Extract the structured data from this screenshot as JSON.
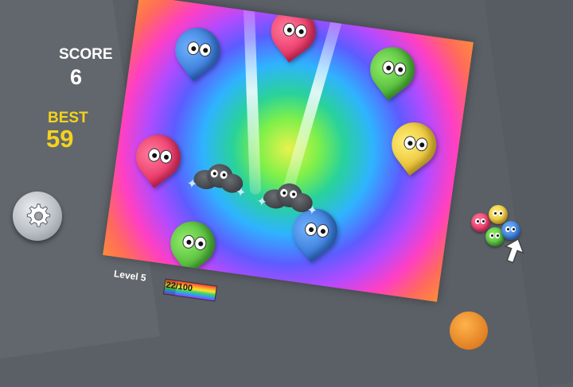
{
  "hud": {
    "score_label": "SCORE",
    "score_value": "6",
    "best_label": "BEST",
    "best_value": "59",
    "settings_icon": "gear-icon"
  },
  "level": {
    "label": "Level 5",
    "progress_text": "22/100",
    "progress_fraction": 0.22
  },
  "board": {
    "background": "radial rainbow gradient",
    "drops": [
      {
        "color": "#ff2f6b",
        "name": "red-drop-top"
      },
      {
        "color": "#2f7fe0",
        "name": "blue-drop-top-left"
      },
      {
        "color": "#4fc23a",
        "name": "green-drop-top-right"
      },
      {
        "color": "#f2c41d",
        "name": "yellow-drop-right"
      },
      {
        "color": "#ff2f6b",
        "name": "red-drop-left"
      },
      {
        "color": "#2f7fe0",
        "name": "blue-drop-bottom-right"
      },
      {
        "color": "#4fc23a",
        "name": "green-drop-bottom-left"
      }
    ],
    "storm_clouds": 2
  },
  "next_cluster": {
    "colors": [
      "#ff2f6b",
      "#f2c41d",
      "#4fc23a",
      "#2f7fe0"
    ],
    "hint_icon": "arrow-up-icon"
  }
}
